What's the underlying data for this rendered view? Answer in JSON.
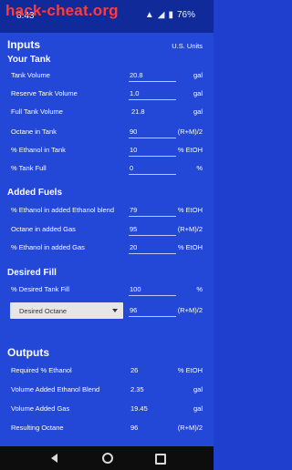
{
  "status": {
    "time": "8:43",
    "battery": "76%"
  },
  "watermark": "hack-cheat.org",
  "header": {
    "inputs": "Inputs",
    "units": "U.S. Units"
  },
  "sections": {
    "your_tank": "Your Tank",
    "added_fuels": "Added Fuels",
    "desired_fill": "Desired Fill",
    "outputs": "Outputs"
  },
  "your_tank": [
    {
      "label": "Tank Volume",
      "value": "20.8",
      "unit": "gal"
    },
    {
      "label": "Reserve Tank Volume",
      "value": "1.0",
      "unit": "gal"
    },
    {
      "label": "Full Tank Volume",
      "value": "21.8",
      "unit": "gal"
    },
    {
      "label": "Octane in Tank",
      "value": "90",
      "unit": "(R+M)/2"
    },
    {
      "label": "% Ethanol in Tank",
      "value": "10",
      "unit": "% EtOH"
    },
    {
      "label": "% Tank Full",
      "value": "0",
      "unit": "%"
    }
  ],
  "added_fuels": [
    {
      "label": "% Ethanol in added Ethanol blend",
      "value": "79",
      "unit": "% EtOH"
    },
    {
      "label": "Octane in added Gas",
      "value": "95",
      "unit": "(R+M)/2"
    },
    {
      "label": "% Ethanol in added Gas",
      "value": "20",
      "unit": "% EtOH"
    }
  ],
  "desired_fill": {
    "percent_label": "% Desired Tank Fill",
    "percent_value": "100",
    "percent_unit": "%",
    "dropdown_selected": "Desired Octane",
    "octane_value": "96",
    "octane_unit": "(R+M)/2"
  },
  "outputs": [
    {
      "label": "Required % Ethanol",
      "value": "26",
      "unit": "% EtOH"
    },
    {
      "label": "Volume Added Ethanol Blend",
      "value": "2.35",
      "unit": "gal"
    },
    {
      "label": "Volume Added Gas",
      "value": "19.45",
      "unit": "gal"
    },
    {
      "label": "Resulting Octane",
      "value": "96",
      "unit": "(R+M)/2"
    }
  ],
  "colors": {
    "background": "#2347d6",
    "statusbar": "#102a9a",
    "watermark": "#ff3b3b"
  },
  "icons": [
    "notification-icon",
    "wifi-icon",
    "battery-icon"
  ]
}
